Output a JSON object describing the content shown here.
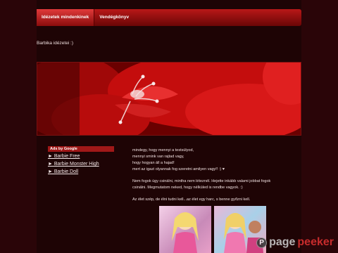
{
  "nav": {
    "items": [
      {
        "label": "Idézetek mindenkinek",
        "active": true
      },
      {
        "label": "Vendégkönyv",
        "active": false
      }
    ]
  },
  "tagline": "Barbika idézetei :)",
  "banner": {
    "icon": "red-flower-banner-image"
  },
  "sidebar": {
    "ads_title": "Ads by Google",
    "links": [
      "► Barbie Free",
      "► Barbie Monster High",
      "► Barbie Doll"
    ]
  },
  "content": {
    "paragraph1": [
      "mindegy, hogy mennyi a testsúlyod,",
      "mennyi smink van rajtad vagy,",
      "hogy hogyan áll a hajad!",
      "mert az igazi olyannak fog szeretni amilyen vagy!! :) ♥"
    ],
    "paragraph2": [
      "Nem fogok úgy csinálni, mintha nem léteznél. Hejette inkább valami jobbat fogok",
      "csinálni. Megmutatom neked, hogy nélküled is rendbe vagyok. :)"
    ],
    "paragraph3": "Az élet szép, de élni tudni kell...az élet egy harc, s benne győzni kell."
  },
  "watermark": {
    "prefix": "page",
    "suffix": "peeker",
    "badge": "P"
  },
  "colors": {
    "background": "#2a0508",
    "accent": "#b81818"
  }
}
